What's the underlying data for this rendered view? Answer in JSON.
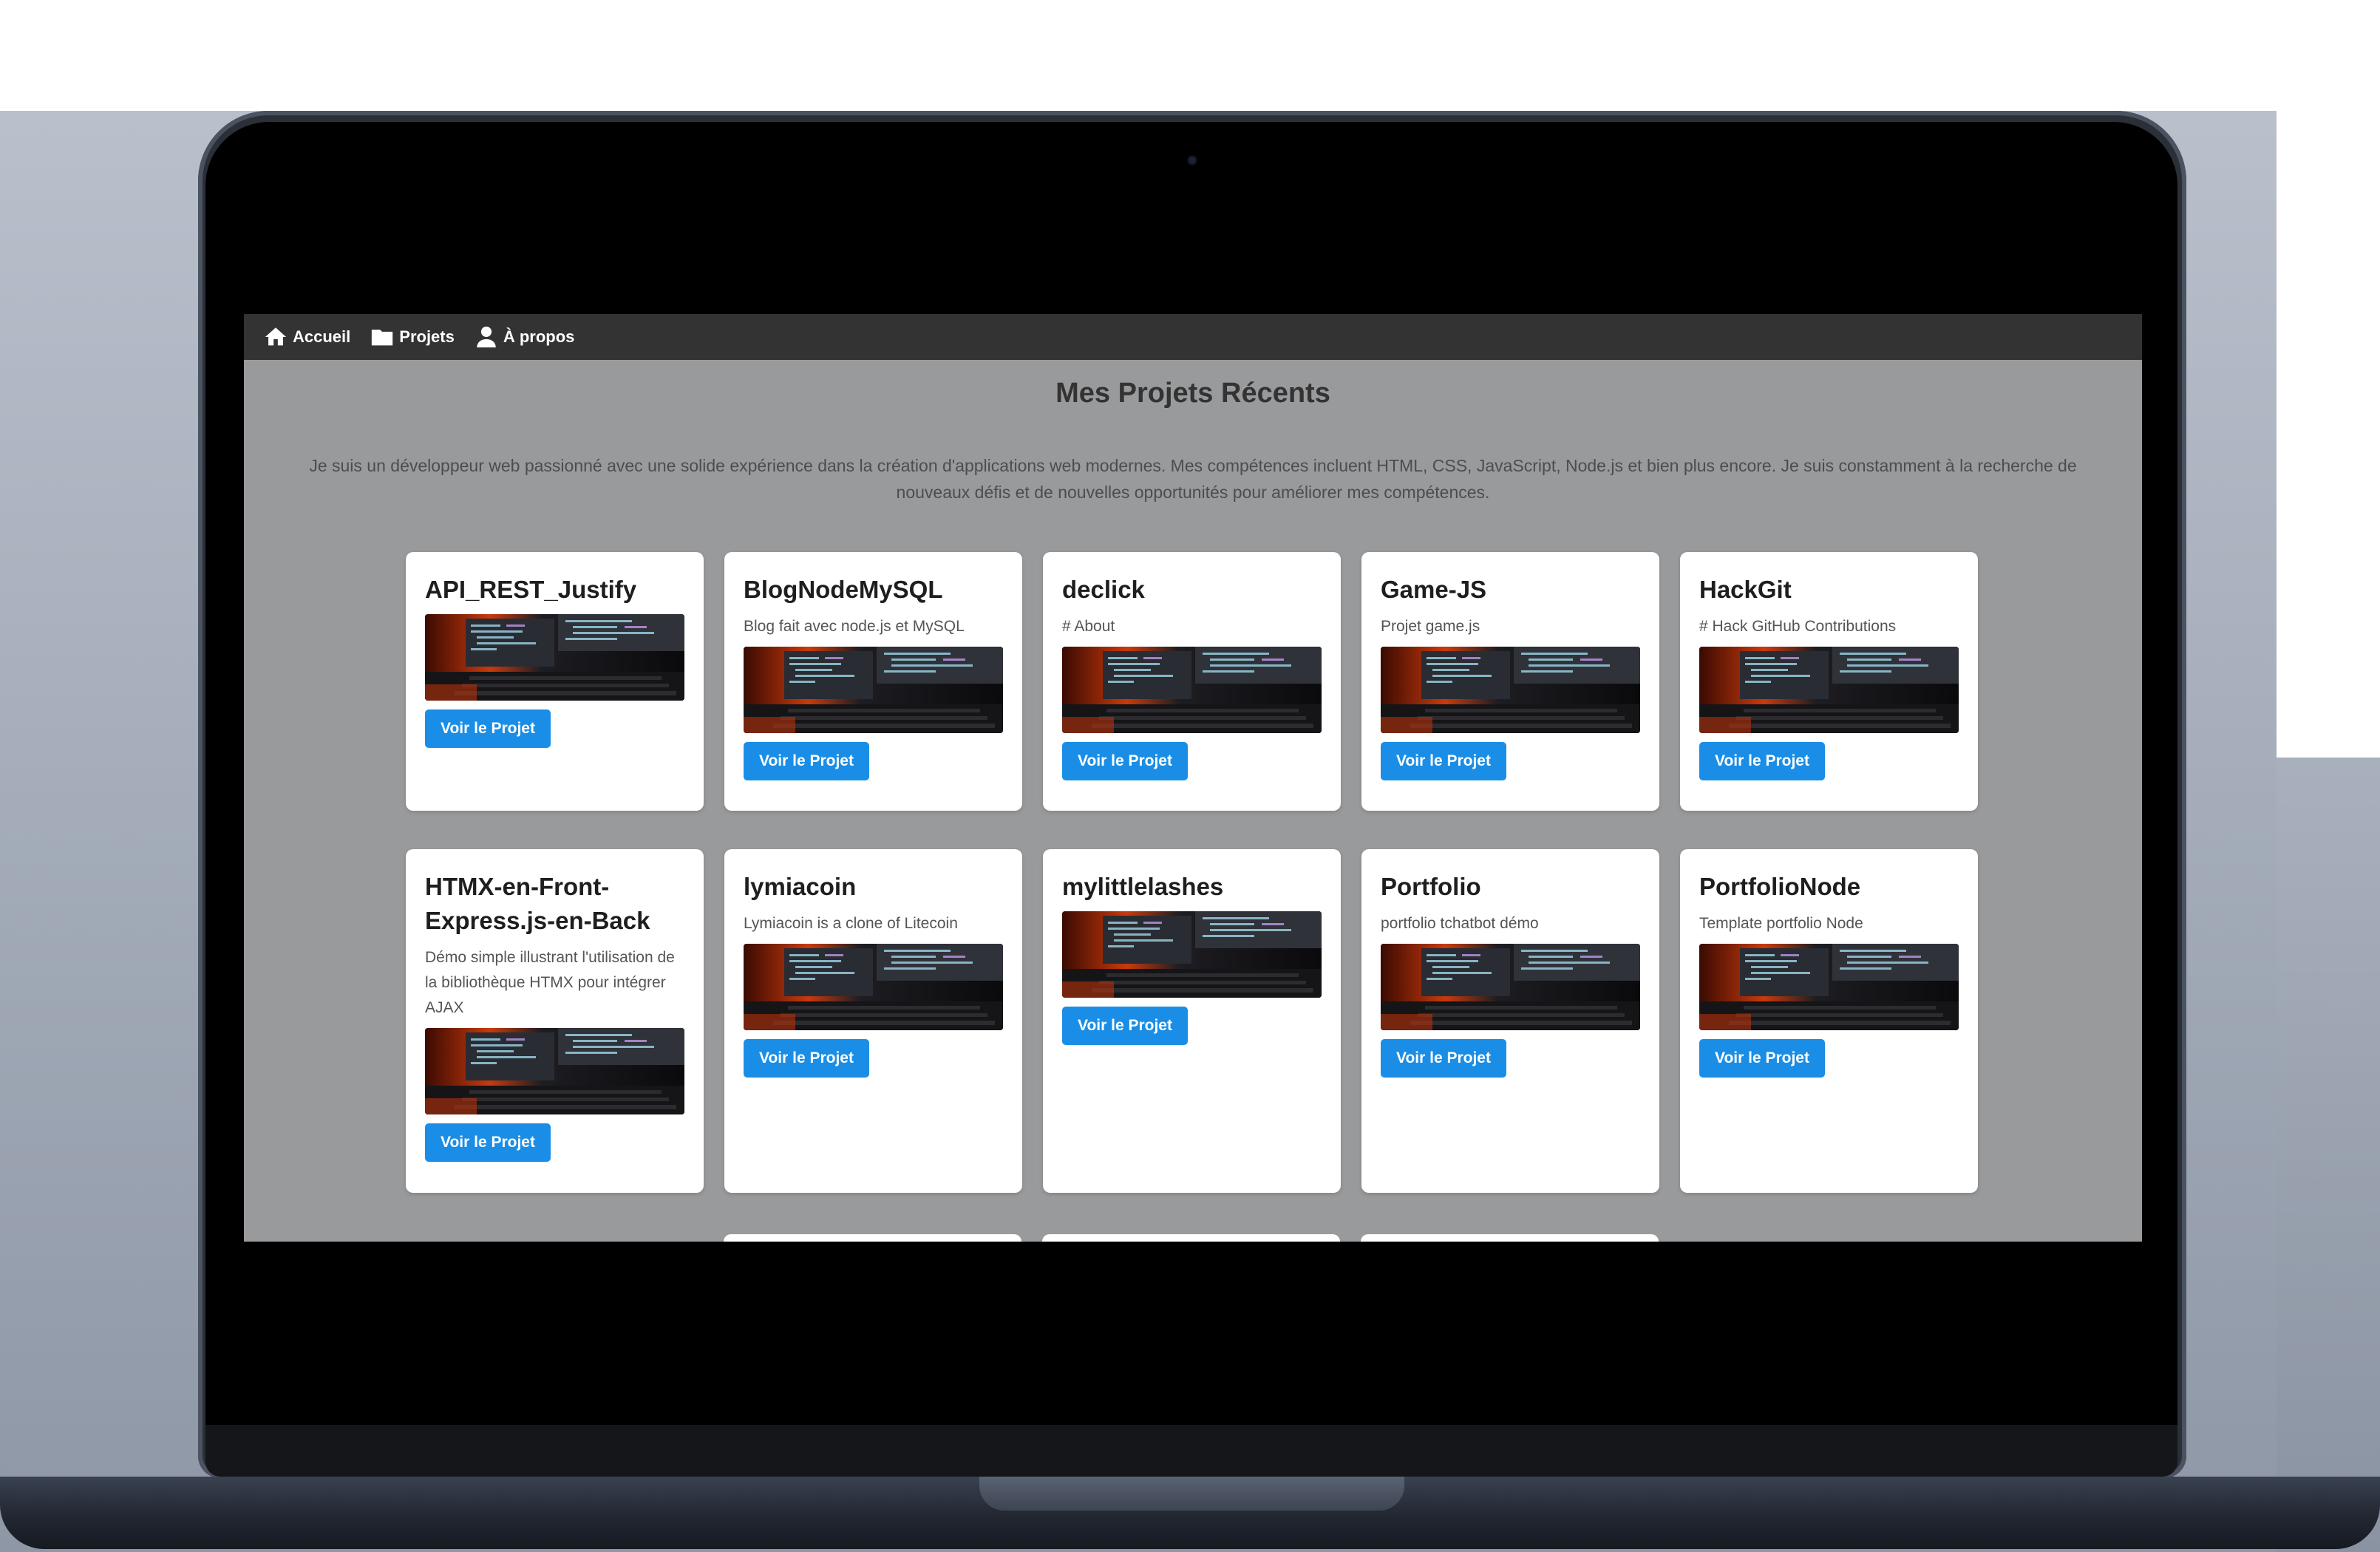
{
  "nav": {
    "items": [
      {
        "label": "Accueil",
        "icon": "home-icon"
      },
      {
        "label": "Projets",
        "icon": "folder-icon"
      },
      {
        "label": "À propos",
        "icon": "user-icon"
      }
    ]
  },
  "main": {
    "title": "Mes Projets Récents",
    "intro": "Je suis un développeur web passionné avec une solide expérience dans la création d'applications web modernes. Mes compétences incluent HTML, CSS, JavaScript, Node.js et bien plus encore. Je suis constamment à la recherche de nouveaux défis et de nouvelles opportunités pour améliorer mes compétences."
  },
  "projects": [
    {
      "title": "API_REST_Justify",
      "desc": "",
      "button": "Voir le Projet"
    },
    {
      "title": "BlogNodeMySQL",
      "desc": "Blog fait avec node.js et MySQL",
      "button": "Voir le Projet"
    },
    {
      "title": "declick",
      "desc": "# About",
      "button": "Voir le Projet"
    },
    {
      "title": "Game-JS",
      "desc": "Projet game.js",
      "button": "Voir le Projet"
    },
    {
      "title": "HackGit",
      "desc": "# Hack GitHub Contributions",
      "button": "Voir le Projet"
    },
    {
      "title": "HTMX-en-Front-Express.js-en-Back",
      "desc": "Démo simple illustrant l'utilisation de la bibliothèque HTMX pour intégrer AJAX",
      "button": "Voir le Projet"
    },
    {
      "title": "lymiacoin",
      "desc": "Lymiacoin is a clone of Litecoin",
      "button": "Voir le Projet"
    },
    {
      "title": "mylittlelashes",
      "desc": "",
      "button": "Voir le Projet"
    },
    {
      "title": "Portfolio",
      "desc": "portfolio tchatbot démo",
      "button": "Voir le Projet"
    },
    {
      "title": "PortfolioNode",
      "desc": "Template portfolio Node",
      "button": "Voir le Projet"
    }
  ],
  "colors": {
    "navbar": "#333333",
    "page_background": "#999a9c",
    "card": "#ffffff",
    "button": "#1a8ee6"
  }
}
